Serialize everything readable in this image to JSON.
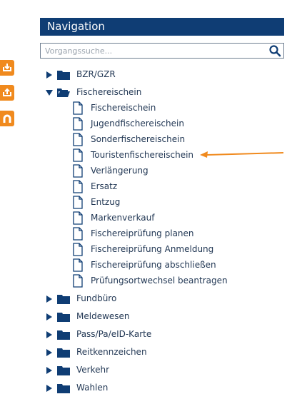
{
  "sidebar": {
    "buttons": [
      {
        "icon": "download-icon"
      },
      {
        "icon": "upload-icon"
      },
      {
        "icon": "magnet-icon"
      }
    ],
    "color": "#f08a1e"
  },
  "nav": {
    "title": "Navigation",
    "header_color": "#0f3d74",
    "search": {
      "placeholder": "Vorgangssuche...",
      "value": ""
    }
  },
  "tree": {
    "groups_before": [
      {
        "label": "BZR/GZR",
        "expanded": false
      }
    ],
    "open_group": {
      "label": "Fischereischein",
      "expanded": true,
      "items": [
        "Fischereischein",
        "Jugendfischereischein",
        "Sonderfischereischein",
        "Touristenfischereischein",
        "Verlängerung",
        "Ersatz",
        "Entzug",
        "Markenverkauf",
        "Fischereiprüfung planen",
        "Fischereiprüfung Anmeldung",
        "Fischereiprüfung abschließen",
        "Prüfungsortwechsel beantragen"
      ]
    },
    "groups_after": [
      {
        "label": "Fundbüro",
        "expanded": false
      },
      {
        "label": "Meldewesen",
        "expanded": false
      },
      {
        "label": "Pass/Pa/eID-Karte",
        "expanded": false
      },
      {
        "label": "Reitkennzeichen",
        "expanded": false
      },
      {
        "label": "Verkehr",
        "expanded": false
      },
      {
        "label": "Wahlen",
        "expanded": false
      }
    ]
  },
  "annotation": {
    "color": "#f08a1e",
    "points_to": "Touristenfischereischein"
  }
}
